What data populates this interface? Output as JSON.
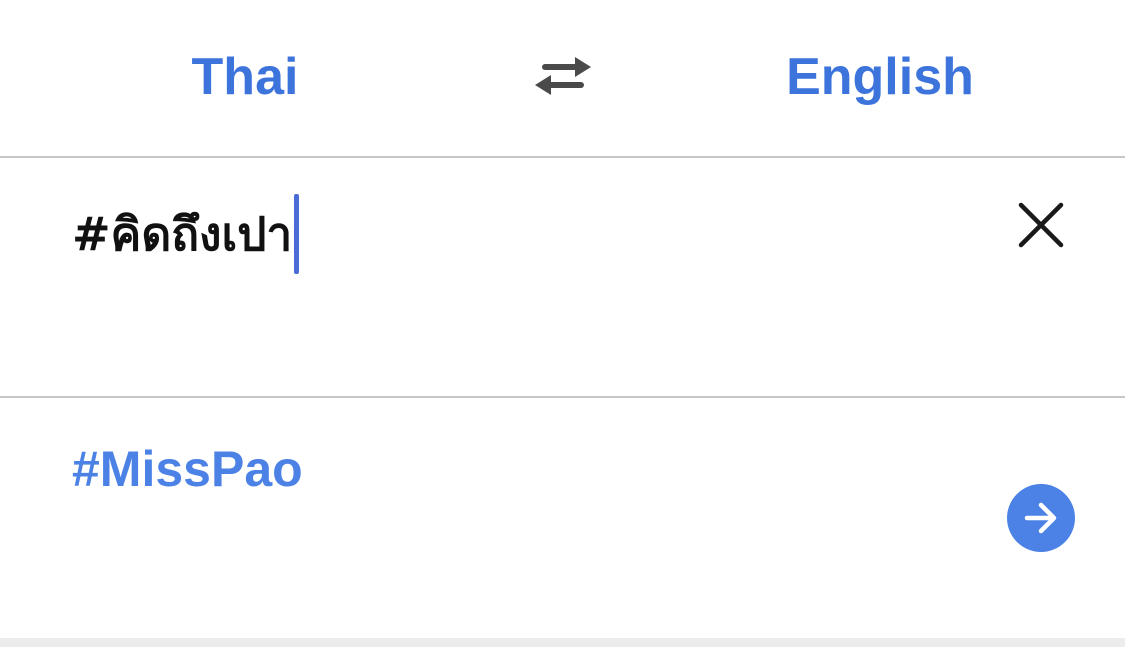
{
  "languages": {
    "source": "Thai",
    "target": "English",
    "swap_icon": "swap-arrows-icon"
  },
  "input": {
    "text": "#คิดถึงเปา",
    "clear_icon": "close-icon"
  },
  "result": {
    "text": "#MissPao",
    "go_icon": "arrow-right-circle-icon"
  },
  "colors": {
    "accent": "#3d74dc",
    "result": "#4c82e6",
    "caret": "#4a6cd4",
    "divider": "#c8c8c8"
  }
}
